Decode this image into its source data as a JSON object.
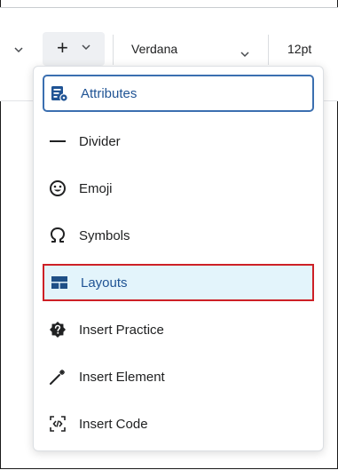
{
  "toolbar": {
    "insert_icon": "plus-icon",
    "font_family": "Verdana",
    "font_size": "12pt"
  },
  "menu": {
    "items": [
      {
        "label": "Attributes",
        "icon": "attributes-icon",
        "state": "focused"
      },
      {
        "label": "Divider",
        "icon": "divider-icon",
        "state": "normal"
      },
      {
        "label": "Emoji",
        "icon": "emoji-icon",
        "state": "normal"
      },
      {
        "label": "Symbols",
        "icon": "omega-icon",
        "state": "normal"
      },
      {
        "label": "Layouts",
        "icon": "layout-icon",
        "state": "selected"
      },
      {
        "label": "Insert Practice",
        "icon": "practice-icon",
        "state": "normal"
      },
      {
        "label": "Insert Element",
        "icon": "magic-wand-icon",
        "state": "normal"
      },
      {
        "label": "Insert Code",
        "icon": "code-icon",
        "state": "normal"
      }
    ]
  },
  "colors": {
    "accent": "#1f5394",
    "focus_border": "#3b6fb0",
    "selected_bg": "#e3f4fb",
    "selected_border": "#cd2026"
  }
}
